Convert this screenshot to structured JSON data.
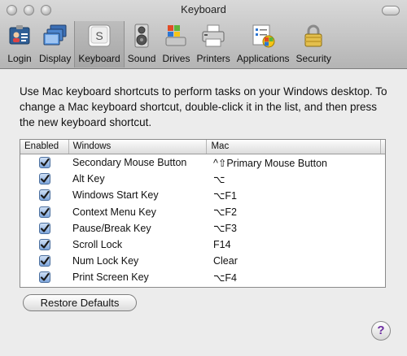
{
  "window": {
    "title": "Keyboard"
  },
  "toolbar": {
    "items": [
      {
        "label": "Login",
        "icon": "login-badge-icon"
      },
      {
        "label": "Display",
        "icon": "display-icon"
      },
      {
        "label": "Keyboard",
        "icon": "keyboard-key-icon",
        "active": true
      },
      {
        "label": "Sound",
        "icon": "speaker-icon"
      },
      {
        "label": "Drives",
        "icon": "drives-icon"
      },
      {
        "label": "Printers",
        "icon": "printer-icon"
      },
      {
        "label": "Applications",
        "icon": "applications-icon"
      },
      {
        "label": "Security",
        "icon": "padlock-icon"
      }
    ],
    "keyboard_key_glyph": "S"
  },
  "instructions": "Use Mac keyboard shortcuts to perform tasks on your Windows desktop. To change a Mac keyboard shortcut, double-click it in the list, and then press the new keyboard shortcut.",
  "table": {
    "headers": {
      "enabled": "Enabled",
      "windows": "Windows",
      "mac": "Mac"
    },
    "rows": [
      {
        "enabled": true,
        "windows": "Secondary Mouse Button",
        "mac": "^⇧Primary Mouse Button"
      },
      {
        "enabled": true,
        "windows": "Alt Key",
        "mac": "⌥"
      },
      {
        "enabled": true,
        "windows": "Windows Start Key",
        "mac": "⌥F1"
      },
      {
        "enabled": true,
        "windows": "Context Menu Key",
        "mac": "⌥F2"
      },
      {
        "enabled": true,
        "windows": "Pause/Break Key",
        "mac": "⌥F3"
      },
      {
        "enabled": true,
        "windows": "Scroll Lock",
        "mac": "F14"
      },
      {
        "enabled": true,
        "windows": "Num Lock Key",
        "mac": "Clear"
      },
      {
        "enabled": true,
        "windows": "Print Screen Key",
        "mac": "⌥F4"
      }
    ]
  },
  "buttons": {
    "restore": "Restore Defaults",
    "help": "?"
  },
  "colors": {
    "checkbox": "#7ea6dc",
    "help_glyph": "#6b2ba0"
  }
}
